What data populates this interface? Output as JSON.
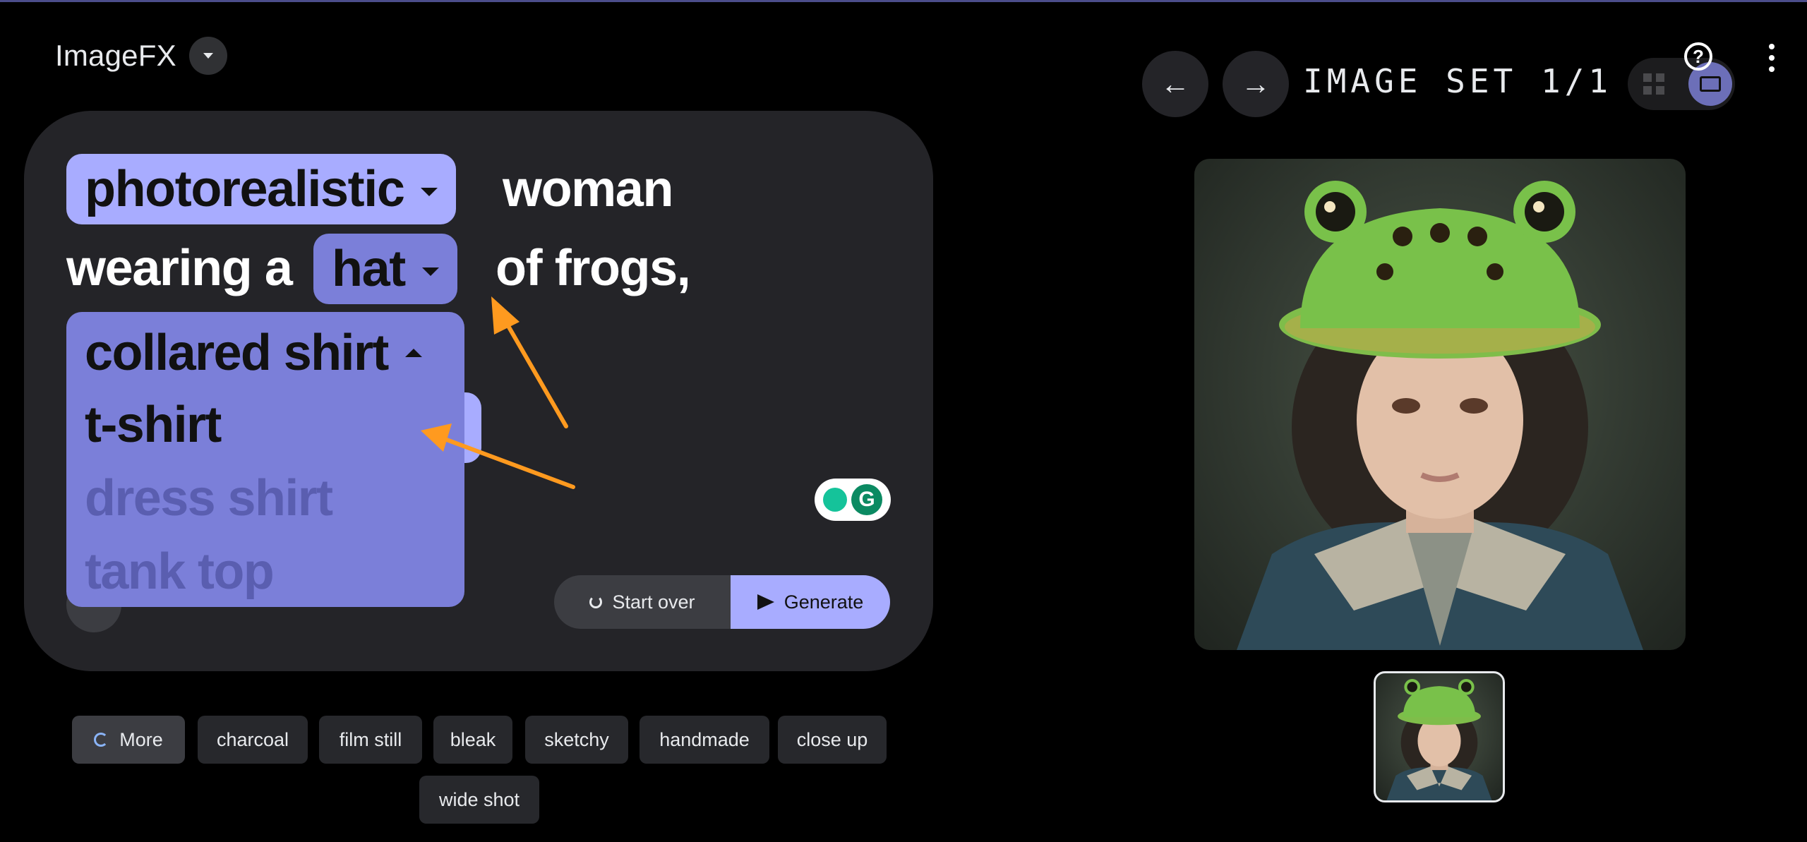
{
  "app": {
    "title": "ImageFX"
  },
  "prompt": {
    "style_chip": "photorealistic",
    "text_1": "woman",
    "text_2": "wearing a",
    "hat_chip": "hat",
    "text_3": "of frogs,"
  },
  "dropdown": {
    "selected": "collared shirt",
    "options": [
      "t-shirt",
      "dress shirt",
      "tank top"
    ]
  },
  "actions": {
    "start_over": "Start over",
    "generate": "Generate"
  },
  "suggestions": {
    "more": "More",
    "chips": [
      "charcoal",
      "film still",
      "bleak",
      "sketchy",
      "handmade",
      "close up",
      "wide shot"
    ]
  },
  "viewer": {
    "set_label": "IMAGE SET 1/1"
  },
  "colors": {
    "accent": "#a8acff",
    "accent_dark": "#7b7fd9",
    "panel": "#242428",
    "annotation_arrow": "#ff9a1f"
  },
  "icons": {
    "brand_dropdown": "chevron-down-icon",
    "back": "arrow-left-icon",
    "forward": "arrow-right-icon",
    "grid_view": "grid-icon",
    "single_view": "single-image-icon",
    "help": "help-icon",
    "menu": "more-vert-icon",
    "start_over": "refresh-icon",
    "generate": "send-sparkle-icon",
    "more": "refresh-icon"
  }
}
